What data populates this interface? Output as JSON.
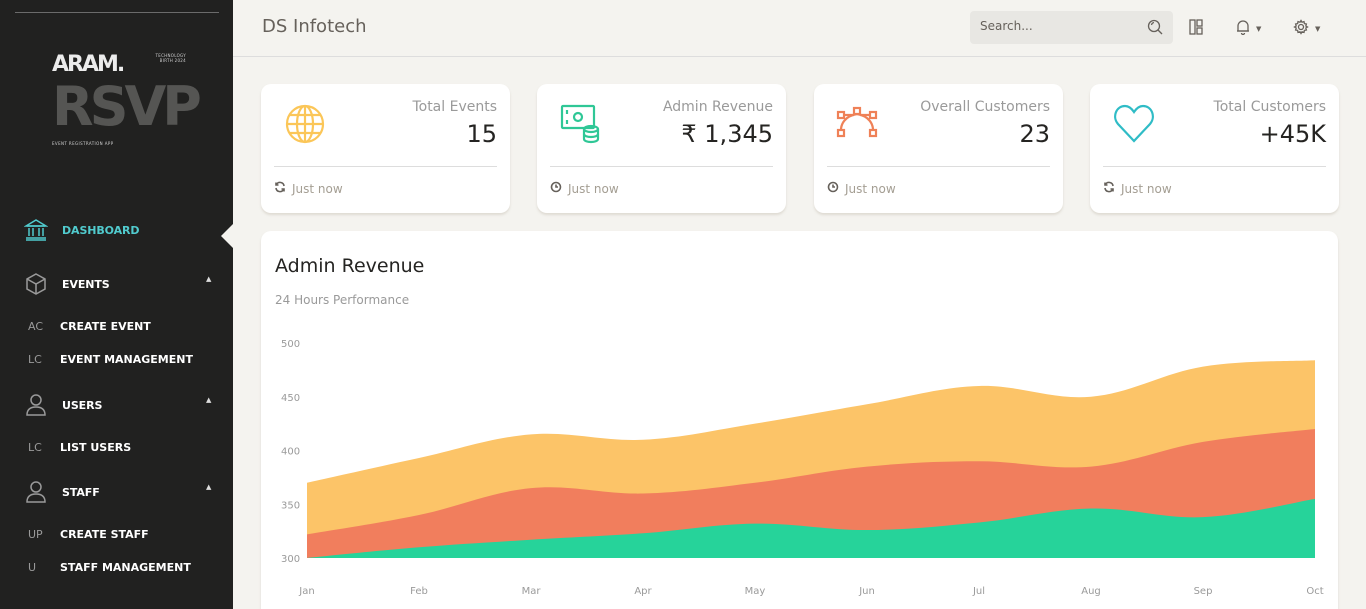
{
  "sidebar": {
    "logo": {
      "aram": "ARAM.",
      "rsvp": "RSVP",
      "tech": "TECHNOLOGY BIRTH 2024",
      "tagline": "EVENT REGISTRATION APP"
    },
    "items": [
      {
        "label": "DASHBOARD",
        "icon": "bank-icon",
        "active": true
      },
      {
        "label": "EVENTS",
        "icon": "box-icon"
      },
      {
        "label": "USERS",
        "icon": "user-icon"
      },
      {
        "label": "STAFF",
        "icon": "user-icon"
      }
    ],
    "sub_items": [
      {
        "abbr": "AC",
        "label": "CREATE EVENT"
      },
      {
        "abbr": "LC",
        "label": "EVENT MANAGEMENT"
      },
      {
        "abbr": "LC",
        "label": "LIST USERS"
      },
      {
        "abbr": "UP",
        "label": "CREATE STAFF"
      },
      {
        "abbr": "U",
        "label": "STAFF MANAGEMENT"
      }
    ]
  },
  "header": {
    "brand": "DS Infotech",
    "search_placeholder": "Search..."
  },
  "cards": [
    {
      "title": "Total Events",
      "value": "15",
      "footer": "Just now",
      "icon": "globe-icon",
      "footer_icon": "refresh-icon",
      "color": "#fbc658"
    },
    {
      "title": "Admin Revenue",
      "value": "₹ 1,345",
      "footer": "Just now",
      "icon": "money-coins-icon",
      "footer_icon": "clock-icon",
      "color": "#6bd098"
    },
    {
      "title": "Overall Customers",
      "value": "23",
      "footer": "Just now",
      "icon": "vector-icon",
      "footer_icon": "clock-icon",
      "color": "#ef8157"
    },
    {
      "title": "Total Customers",
      "value": "+45K",
      "footer": "Just now",
      "icon": "heart-icon",
      "footer_icon": "refresh-icon",
      "color": "#51cbce"
    }
  ],
  "chart": {
    "title": "Admin Revenue",
    "subtitle": "24 Hours Performance"
  },
  "chart_data": {
    "type": "area",
    "categories": [
      "Jan",
      "Feb",
      "Mar",
      "Apr",
      "May",
      "Jun",
      "Jul",
      "Aug",
      "Sep",
      "Oct"
    ],
    "ylim": [
      300,
      500
    ],
    "yticks": [
      300,
      350,
      400,
      450,
      500
    ],
    "grid": false,
    "series": [
      {
        "values": [
          370,
          393,
          415,
          410,
          425,
          443,
          460,
          450,
          478,
          484
        ],
        "color": "#fcc468"
      },
      {
        "values": [
          322,
          340,
          365,
          360,
          370,
          385,
          390,
          385,
          408,
          420
        ],
        "color": "#f17e5d"
      },
      {
        "values": [
          300,
          310,
          317,
          323,
          332,
          326,
          333,
          346,
          338,
          355
        ],
        "color": "#26d39a"
      }
    ]
  }
}
